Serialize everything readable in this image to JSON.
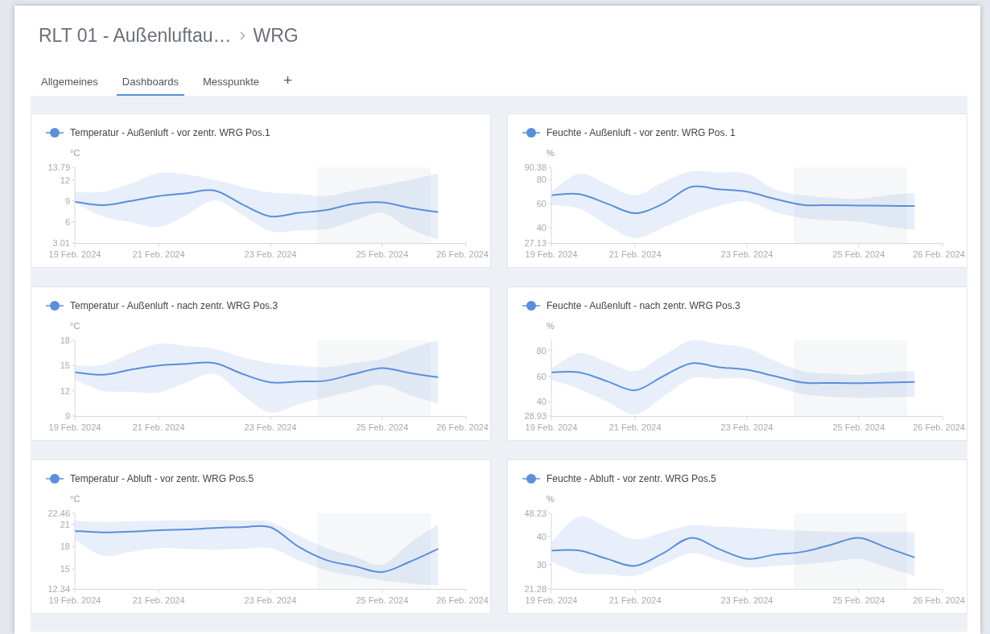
{
  "breadcrumb": {
    "items": [
      "RLT 01 - Außenluftau…",
      "WRG"
    ]
  },
  "tabs": [
    {
      "label": "Allgemeines",
      "selected": false
    },
    {
      "label": "Dashboards",
      "selected": true
    },
    {
      "label": "Messpunkte",
      "selected": false
    }
  ],
  "add_tab": "+",
  "charts": [
    {
      "chart_data": {
        "type": "line",
        "ylabel": "°C",
        "categories": [
          "19 Feb. 2024",
          null,
          null,
          "21 Feb. 2024",
          null,
          null,
          null,
          "23 Feb. 2024",
          null,
          null,
          null,
          "25 Feb. 2024",
          null,
          null,
          "26 Feb. 2024"
        ],
        "ylim": [
          3.01,
          13.79
        ],
        "yticks": [
          3.01,
          6,
          9,
          12,
          13.79
        ],
        "series": [
          {
            "name": "Temperatur - Außenluft - vor zentr. WRG Pos.1",
            "color": "#5b8fd9",
            "values": [
              8.9,
              8.4,
              9.0,
              9.7,
              10.1,
              10.5,
              8.5,
              6.8,
              7.3,
              7.7,
              8.6,
              8.8,
              8.0,
              7.4,
              null
            ],
            "upper": [
              10.3,
              10.3,
              11.5,
              13,
              12.8,
              12,
              11,
              10.2,
              10,
              9.7,
              10.5,
              11.2,
              12,
              12.9,
              null
            ],
            "lower": [
              8.8,
              6.8,
              6.0,
              5.3,
              7,
              9.1,
              7,
              4.7,
              4.8,
              5.0,
              6.2,
              7.3,
              5,
              3.5,
              null
            ]
          }
        ]
      }
    },
    {
      "chart_data": {
        "type": "line",
        "ylabel": "%",
        "categories": [
          "19 Feb. 2024",
          null,
          null,
          "21 Feb. 2024",
          null,
          null,
          null,
          "23 Feb. 2024",
          null,
          null,
          null,
          "25 Feb. 2024",
          null,
          null,
          "26 Feb. 2024"
        ],
        "ylim": [
          27.13,
          90.38
        ],
        "yticks": [
          27.13,
          40,
          60,
          80,
          90.38
        ],
        "series": [
          {
            "name": "Feuchte - Außenluft - vor zentr. WRG Pos. 1",
            "color": "#5b8fd9",
            "values": [
              67,
              68,
              60,
              52,
              60,
              74,
              72,
              70,
              64,
              59,
              58.8,
              58.5,
              58.2,
              58,
              null
            ],
            "upper": [
              70,
              85,
              76,
              67,
              78,
              87,
              86,
              85,
              72,
              67,
              65,
              64,
              67,
              69,
              null
            ],
            "lower": [
              59,
              56,
              42,
              31,
              40,
              50,
              58,
              62,
              53,
              48,
              46,
              45,
              41,
              38,
              null
            ]
          }
        ]
      }
    },
    {
      "chart_data": {
        "type": "line",
        "ylabel": "°C",
        "categories": [
          "19 Feb. 2024",
          null,
          null,
          "21 Feb. 2024",
          null,
          null,
          null,
          "23 Feb. 2024",
          null,
          null,
          null,
          "25 Feb. 2024",
          null,
          null,
          "26 Feb. 2024"
        ],
        "ylim": [
          9,
          18
        ],
        "yticks": [
          9,
          12,
          15,
          18
        ],
        "series": [
          {
            "name": "Temperatur - Außenluft - nach zentr. WRG Pos.3",
            "color": "#5b8fd9",
            "values": [
              14.2,
              13.9,
              14.5,
              15.0,
              15.2,
              15.3,
              14,
              13.0,
              13.1,
              13.2,
              14,
              14.7,
              14.1,
              13.6,
              null
            ],
            "upper": [
              15,
              15.1,
              16.5,
              17.6,
              17.3,
              17,
              16,
              15.3,
              15,
              14.8,
              15.3,
              15.8,
              17,
              18,
              null
            ],
            "lower": [
              13.3,
              12,
              11.9,
              11.8,
              13,
              14,
              11.5,
              9.4,
              10.4,
              11.2,
              12,
              12.7,
              11.5,
              10.5,
              null
            ]
          }
        ]
      }
    },
    {
      "chart_data": {
        "type": "line",
        "ylabel": "%",
        "categories": [
          "19 Feb. 2024",
          null,
          null,
          "21 Feb. 2024",
          null,
          null,
          null,
          "23 Feb. 2024",
          null,
          null,
          null,
          "25 Feb. 2024",
          null,
          null,
          "26 Feb. 2024"
        ],
        "ylim": [
          28.93,
          88
        ],
        "yticks": [
          28.93,
          40,
          60,
          80
        ],
        "series": [
          {
            "name": "Feuchte - Außenluft - nach zentr. WRG Pos.3",
            "color": "#5b8fd9",
            "values": [
              63,
              63,
              56,
              49,
              60,
              70,
              67,
              65,
              60,
              55,
              54.7,
              54.5,
              55,
              55.5,
              null
            ],
            "upper": [
              66,
              78,
              71,
              64,
              76,
              88,
              85,
              82,
              72,
              64,
              62,
              61,
              63,
              64,
              null
            ],
            "lower": [
              57,
              50,
              40,
              30,
              44,
              58,
              58,
              58,
              52,
              46,
              44,
              43,
              43.5,
              44,
              null
            ]
          }
        ]
      }
    },
    {
      "chart_data": {
        "type": "line",
        "ylabel": "°C",
        "categories": [
          "19 Feb. 2024",
          null,
          null,
          "21 Feb. 2024",
          null,
          null,
          null,
          "23 Feb. 2024",
          null,
          null,
          null,
          "25 Feb. 2024",
          null,
          null,
          "26 Feb. 2024"
        ],
        "ylim": [
          12.34,
          22.46
        ],
        "yticks": [
          12.34,
          15,
          18,
          21,
          22.46
        ],
        "series": [
          {
            "name": "Temperatur - Abluft - vor zentr. WRG Pos.5",
            "color": "#5b8fd9",
            "values": [
              20.1,
              19.9,
              20.0,
              20.2,
              20.3,
              20.5,
              20.6,
              20.6,
              18,
              16.2,
              15.4,
              14.6,
              16,
              17.7,
              null
            ],
            "upper": [
              21.5,
              21.3,
              21.4,
              21.5,
              21.5,
              21.6,
              21.5,
              21.3,
              19.5,
              17.8,
              16.7,
              15.6,
              18.5,
              21,
              null
            ],
            "lower": [
              19,
              16.8,
              17.3,
              17.8,
              17.7,
              17.6,
              17.7,
              17.8,
              16.2,
              14.8,
              14.1,
              13.5,
              13.1,
              12.8,
              null
            ]
          }
        ]
      }
    },
    {
      "chart_data": {
        "type": "line",
        "ylabel": "%",
        "categories": [
          "19 Feb. 2024",
          null,
          null,
          "21 Feb. 2024",
          null,
          null,
          null,
          "23 Feb. 2024",
          null,
          null,
          null,
          "25 Feb. 2024",
          null,
          null,
          "26 Feb. 2024"
        ],
        "ylim": [
          21.28,
          48.23
        ],
        "yticks": [
          21.28,
          30,
          40,
          48.23
        ],
        "series": [
          {
            "name": "Feuchte - Abluft - vor zentr. WRG Pos.5",
            "color": "#5b8fd9",
            "values": [
              35,
              35,
              32,
              29.5,
              34,
              39.5,
              35.5,
              32,
              33.5,
              34.5,
              37,
              39.5,
              36,
              32.5,
              null
            ],
            "upper": [
              38,
              47,
              43,
              39,
              41.5,
              44,
              43.5,
              43,
              42.5,
              42,
              41.7,
              41.5,
              41.5,
              41.5,
              null
            ],
            "lower": [
              31,
              27,
              26.5,
              26,
              30,
              34,
              31.5,
              29,
              29.5,
              30,
              31,
              32,
              29,
              26,
              null
            ]
          }
        ]
      }
    }
  ]
}
